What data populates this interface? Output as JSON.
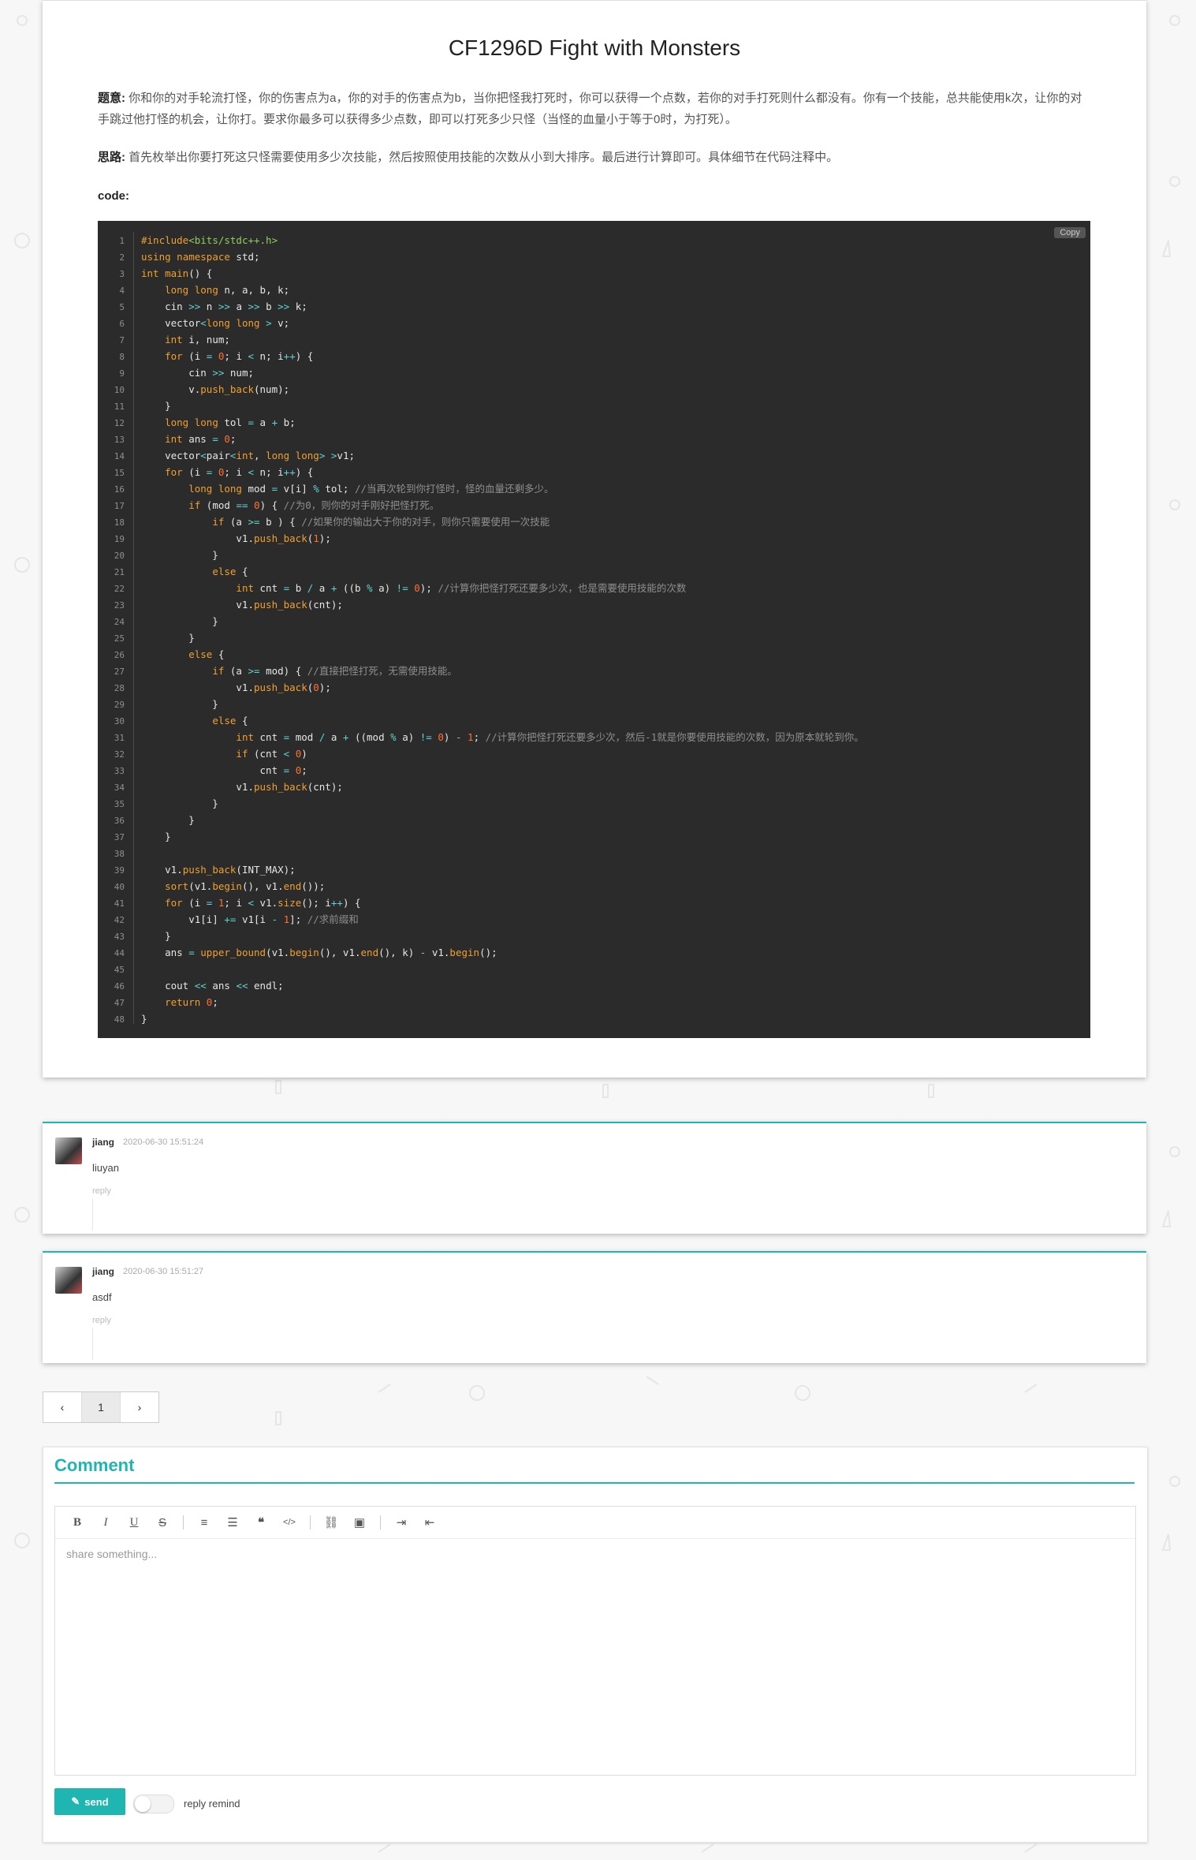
{
  "article": {
    "title": "CF1296D Fight with Monsters",
    "desc_label": "题意:",
    "desc_text": "你和你的对手轮流打怪，你的伤害点为a，你的对手的伤害点为b，当你把怪我打死时，你可以获得一个点数，若你的对手打死则什么都没有。你有一个技能，总共能使用k次，让你的对手跳过他打怪的机会，让你打。要求你最多可以获得多少点数，即可以打死多少只怪（当怪的血量小于等于0时，为打死）。",
    "idea_label": "思路:",
    "idea_text": "首先枚举出你要打死这只怪需要使用多少次技能，然后按照使用技能的次数从小到大排序。最后进行计算即可。具体细节在代码注释中。",
    "code_label": "code:",
    "copy_label": "Copy"
  },
  "code_lines": [
    "#include<bits/stdc++.h>",
    "using namespace std;",
    "int main() {",
    "    long long n, a, b, k;",
    "    cin >> n >> a >> b >> k;",
    "    vector<long long > v;",
    "    int i, num;",
    "    for (i = 0; i < n; i++) {",
    "        cin >> num;",
    "        v.push_back(num);",
    "    }",
    "    long long tol = a + b;",
    "    int ans = 0;",
    "    vector<pair<int, long long> >v1;",
    "    for (i = 0; i < n; i++) {",
    "        long long mod = v[i] % tol; //当再次轮到你打怪时，怪的血量还剩多少。",
    "        if (mod == 0) { //为0，则你的对手刚好把怪打死。",
    "            if (a >= b ) { //如果你的输出大于你的对手，则你只需要使用一次技能",
    "                v1.push_back(1);",
    "            }",
    "            else {",
    "                int cnt = b / a + ((b % a) != 0); //计算你把怪打死还要多少次，也是需要使用技能的次数",
    "                v1.push_back(cnt);",
    "            }",
    "        }",
    "        else {",
    "            if (a >= mod) { //直接把怪打死，无需使用技能。",
    "                v1.push_back(0);",
    "            }",
    "            else {",
    "                int cnt = mod / a + ((mod % a) != 0) - 1; //计算你把怪打死还要多少次，然后-1就是你要使用技能的次数，因为原本就轮到你。",
    "                if (cnt < 0)",
    "                    cnt = 0;",
    "                v1.push_back(cnt);",
    "            }",
    "        }",
    "    }",
    "",
    "    v1.push_back(INT_MAX);",
    "    sort(v1.begin(), v1.end());",
    "    for (i = 1; i < v1.size(); i++) {",
    "        v1[i] += v1[i - 1]; //求前缀和",
    "    }",
    "    ans = upper_bound(v1.begin(), v1.end(), k) - v1.begin();",
    "",
    "    cout << ans << endl;",
    "    return 0;",
    "}"
  ],
  "comments": [
    {
      "user": "jiang",
      "time": "2020-06-30 15:51:24",
      "text": "liuyan",
      "reply": "reply"
    },
    {
      "user": "jiang",
      "time": "2020-06-30 15:51:27",
      "text": "asdf",
      "reply": "reply"
    }
  ],
  "pagination": {
    "prev": "‹",
    "current": "1",
    "next": "›"
  },
  "comment_box": {
    "title": "Comment",
    "placeholder": "share something...",
    "send_label": "send",
    "remind_label": "reply remind",
    "toolbar": [
      "bold-icon",
      "italic-icon",
      "underline-icon",
      "strikethrough-icon",
      "ordered-list-icon",
      "bullet-list-icon",
      "quote-icon",
      "code-icon",
      "link-icon",
      "image-icon",
      "indent-icon",
      "outdent-icon"
    ]
  },
  "colors": {
    "accent": "#1fb5b0",
    "code_bg": "#2b2b2b"
  }
}
